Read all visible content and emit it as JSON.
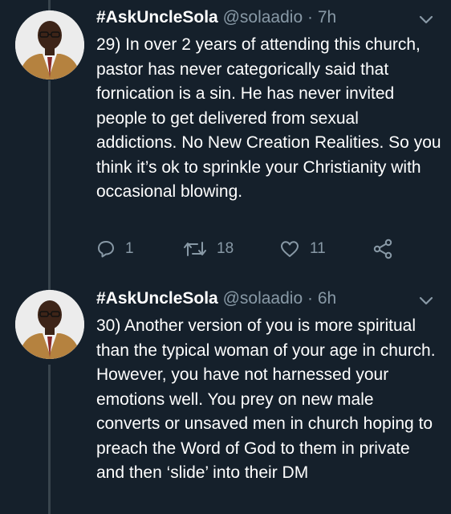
{
  "tweets": [
    {
      "author": "#AskUncleSola",
      "handle": "@solaadio",
      "time": "7h",
      "text": "29) In over 2 years of attending this church, pastor has never categorically said that fornication is a sin. He has never invited people to get delivered from sexual addictions. No New Creation Realities. So you think it’s ok to sprinkle your Christianity with occasional blowing.",
      "replies": "1",
      "retweets": "18",
      "likes": "11"
    },
    {
      "author": "#AskUncleSola",
      "handle": "@solaadio",
      "time": "6h",
      "text": "30) Another version of you is more spiritual than the typical woman of your age in church. However, you have not harnessed your emotions well. You prey on new male converts or unsaved men in church hoping to preach the Word of God to them in private and then ‘slide’ into their DM"
    }
  ],
  "separator": " · ",
  "icons": [
    "reply-icon",
    "retweet-icon",
    "like-icon",
    "share-icon",
    "chevron-down-icon"
  ],
  "colors": {
    "background": "#15202b",
    "secondary_text": "#8899a6",
    "thread_line": "#38444d"
  }
}
